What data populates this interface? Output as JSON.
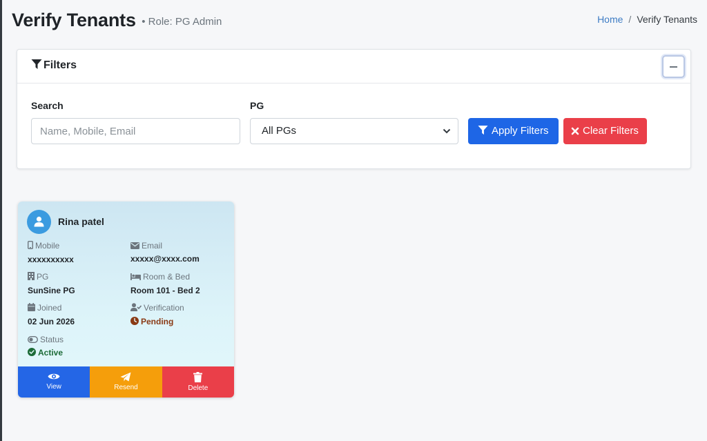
{
  "header": {
    "title": "Verify Tenants",
    "role": "• Role: PG Admin",
    "breadcrumb": {
      "home": "Home",
      "separator": "/",
      "current": "Verify Tenants"
    }
  },
  "filters": {
    "title": "Filters",
    "search_label": "Search",
    "search_placeholder": "Name, Mobile, Email",
    "search_value": "",
    "pg_label": "PG",
    "pg_selected": "All PGs",
    "apply_label": "Apply Filters",
    "clear_label": "Clear Filters"
  },
  "tenant": {
    "name": "Rina patel",
    "mobile_label": "Mobile",
    "mobile": "xxxxxxxxxx",
    "email_label": "Email",
    "email": "xxxxx@xxxx.com",
    "pg_label": "PG",
    "pg": "SunSine PG",
    "room_label": "Room & Bed",
    "room": "Room 101 - Bed 2",
    "joined_label": "Joined",
    "joined": "02 Jun 2026",
    "verification_label": "Verification",
    "verification": "Pending",
    "status_label": "Status",
    "status": "Active",
    "actions": {
      "view": "View",
      "resend": "Resend",
      "delete": "Delete"
    }
  },
  "colors": {
    "primary": "#1e66e6",
    "danger": "#ea3f49",
    "warning": "#f59e0b",
    "pending": "#8a3a15",
    "active": "#1c6b37",
    "link": "#3d7cc4"
  },
  "icons": {
    "filter": "filter-icon",
    "collapse": "minus-icon",
    "avatar": "user-icon",
    "mobile": "mobile-icon",
    "email": "envelope-icon",
    "pg": "building-icon",
    "room": "bed-icon",
    "joined": "calendar-icon",
    "verification": "user-check-icon",
    "pending": "clock-icon",
    "status": "toggle-icon",
    "active": "check-circle-icon",
    "view": "eye-icon",
    "resend": "paper-plane-icon",
    "delete": "trash-icon"
  }
}
